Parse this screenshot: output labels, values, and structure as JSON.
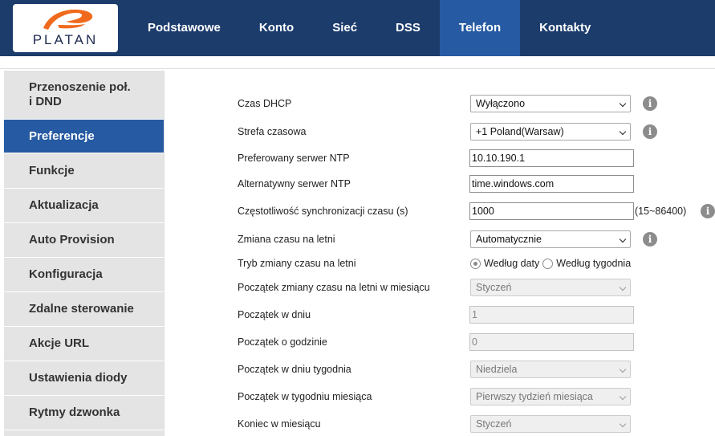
{
  "brand": {
    "logo_text": "PLATAN"
  },
  "nav": {
    "items": [
      {
        "label": "Podstawowe"
      },
      {
        "label": "Konto"
      },
      {
        "label": "Sieć"
      },
      {
        "label": "DSS"
      },
      {
        "label": "Telefon"
      },
      {
        "label": "Kontakty"
      }
    ],
    "active": "Telefon"
  },
  "sidebar": {
    "items": [
      {
        "label": "Przenoszenie poł. i DND"
      },
      {
        "label": "Preferencje"
      },
      {
        "label": "Funkcje"
      },
      {
        "label": "Aktualizacja"
      },
      {
        "label": "Auto Provision"
      },
      {
        "label": "Konfiguracja"
      },
      {
        "label": "Zdalne sterowanie"
      },
      {
        "label": "Akcje URL"
      },
      {
        "label": "Ustawienia diody"
      },
      {
        "label": "Rytmy dzwonka"
      }
    ],
    "active": "Preferencje"
  },
  "form": {
    "dhcp_time": {
      "label": "Czas DHCP",
      "value": "Wyłączono"
    },
    "timezone": {
      "label": "Strefa czasowa",
      "value": "+1 Poland(Warsaw)"
    },
    "ntp_primary": {
      "label": "Preferowany serwer NTP",
      "value": "10.10.190.1"
    },
    "ntp_secondary": {
      "label": "Alternatywny serwer NTP",
      "value": "time.windows.com"
    },
    "sync_interval": {
      "label": "Częstotliwość synchronizacji czasu (s)",
      "value": "1000",
      "range": "(15~86400)"
    },
    "dst": {
      "label": "Zmiana czasu na letni",
      "value": "Automatycznie"
    },
    "dst_mode": {
      "label": "Tryb zmiany czasu na letni",
      "option_date": "Według daty",
      "option_week": "Według tygodnia",
      "selected": "Według daty"
    },
    "dst_start_month": {
      "label": "Początek zmiany czasu na letni w miesiącu",
      "value": "Styczeń"
    },
    "start_day": {
      "label": "Początek w dniu",
      "value": "1"
    },
    "start_hour": {
      "label": "Początek o godzinie",
      "value": "0"
    },
    "start_weekday": {
      "label": "Początek w dniu tygodnia",
      "value": "Niedziela"
    },
    "start_week_of_month": {
      "label": "Początek w tygodniu miesiąca",
      "value": "Pierwszy tydzień miesiąca"
    },
    "end_month": {
      "label": "Koniec w miesiącu",
      "value": "Styczeń"
    }
  },
  "colors": {
    "header_bg": "#1c3c6c",
    "active_bg": "#265aa2",
    "sidebar_bg": "#e4e4e4",
    "logo_orange": "#f06a1e",
    "info_icon": "#8c8c8c"
  },
  "icons": {
    "info": "i",
    "select_caret": "chevron-down-icon",
    "logo": "platan-logo"
  }
}
